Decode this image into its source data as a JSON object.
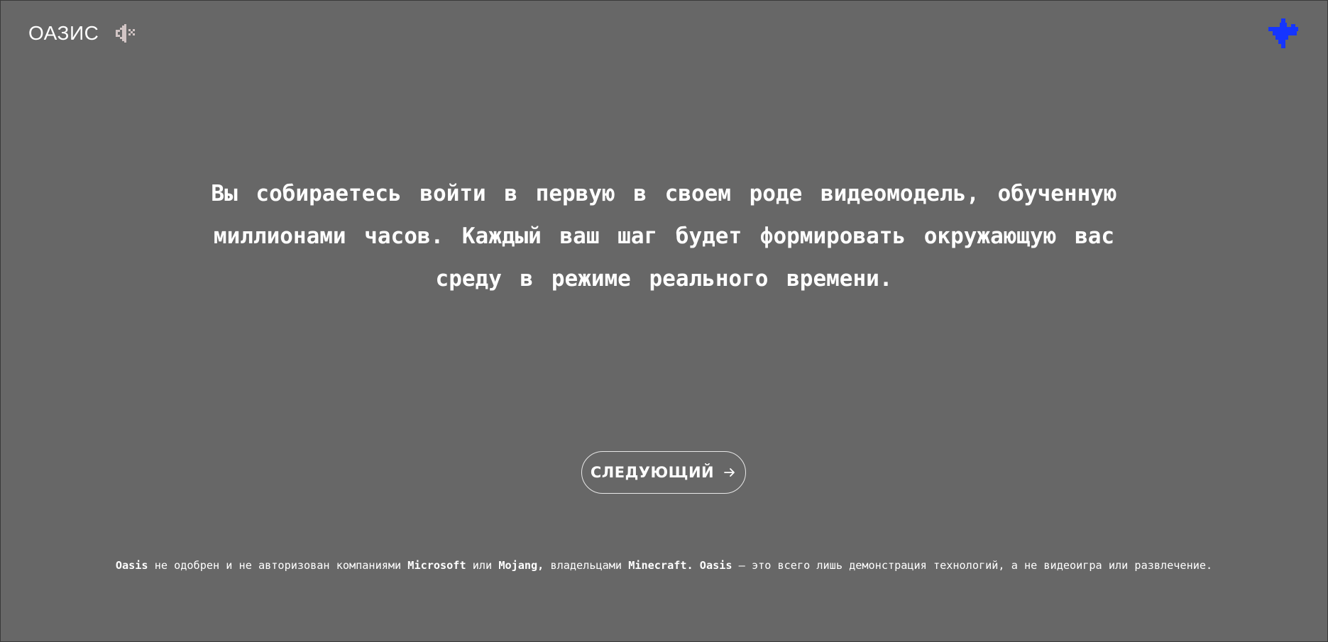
{
  "header": {
    "brand": "ОАЗИС",
    "mute_icon": "speaker-muted-icon",
    "logo_icon": "pixel-star-logo-icon",
    "logo_color": "#1535ff"
  },
  "intro": {
    "lines": [
      "Вы собираетесь войти в первую в своем роде видеомодель, обученную",
      "миллионами часов. Каждый ваш шаг будет формировать окружающую вас",
      "среду в режиме реального времени."
    ]
  },
  "actions": {
    "next_label": "СЛЕДУЮЩИЙ",
    "next_icon": "arrow-right-icon"
  },
  "disclaimer": {
    "oasis": "Oasis",
    "t1": " не одобрен и не авторизован компаниями ",
    "microsoft": "Microsoft",
    "t2": " или ",
    "mojang": "Mojang,",
    "t3": " владельцами ",
    "minecraft": "Minecraft.",
    "t4": " ",
    "oasis2": "Oasis",
    "t5": " — это всего лишь демонстрация технологий, а не видеоигра или развлечение."
  },
  "colors": {
    "background": "#676767",
    "text": "#ffffff",
    "mute_icon": "#d2c5c5",
    "accent": "#1535ff"
  }
}
